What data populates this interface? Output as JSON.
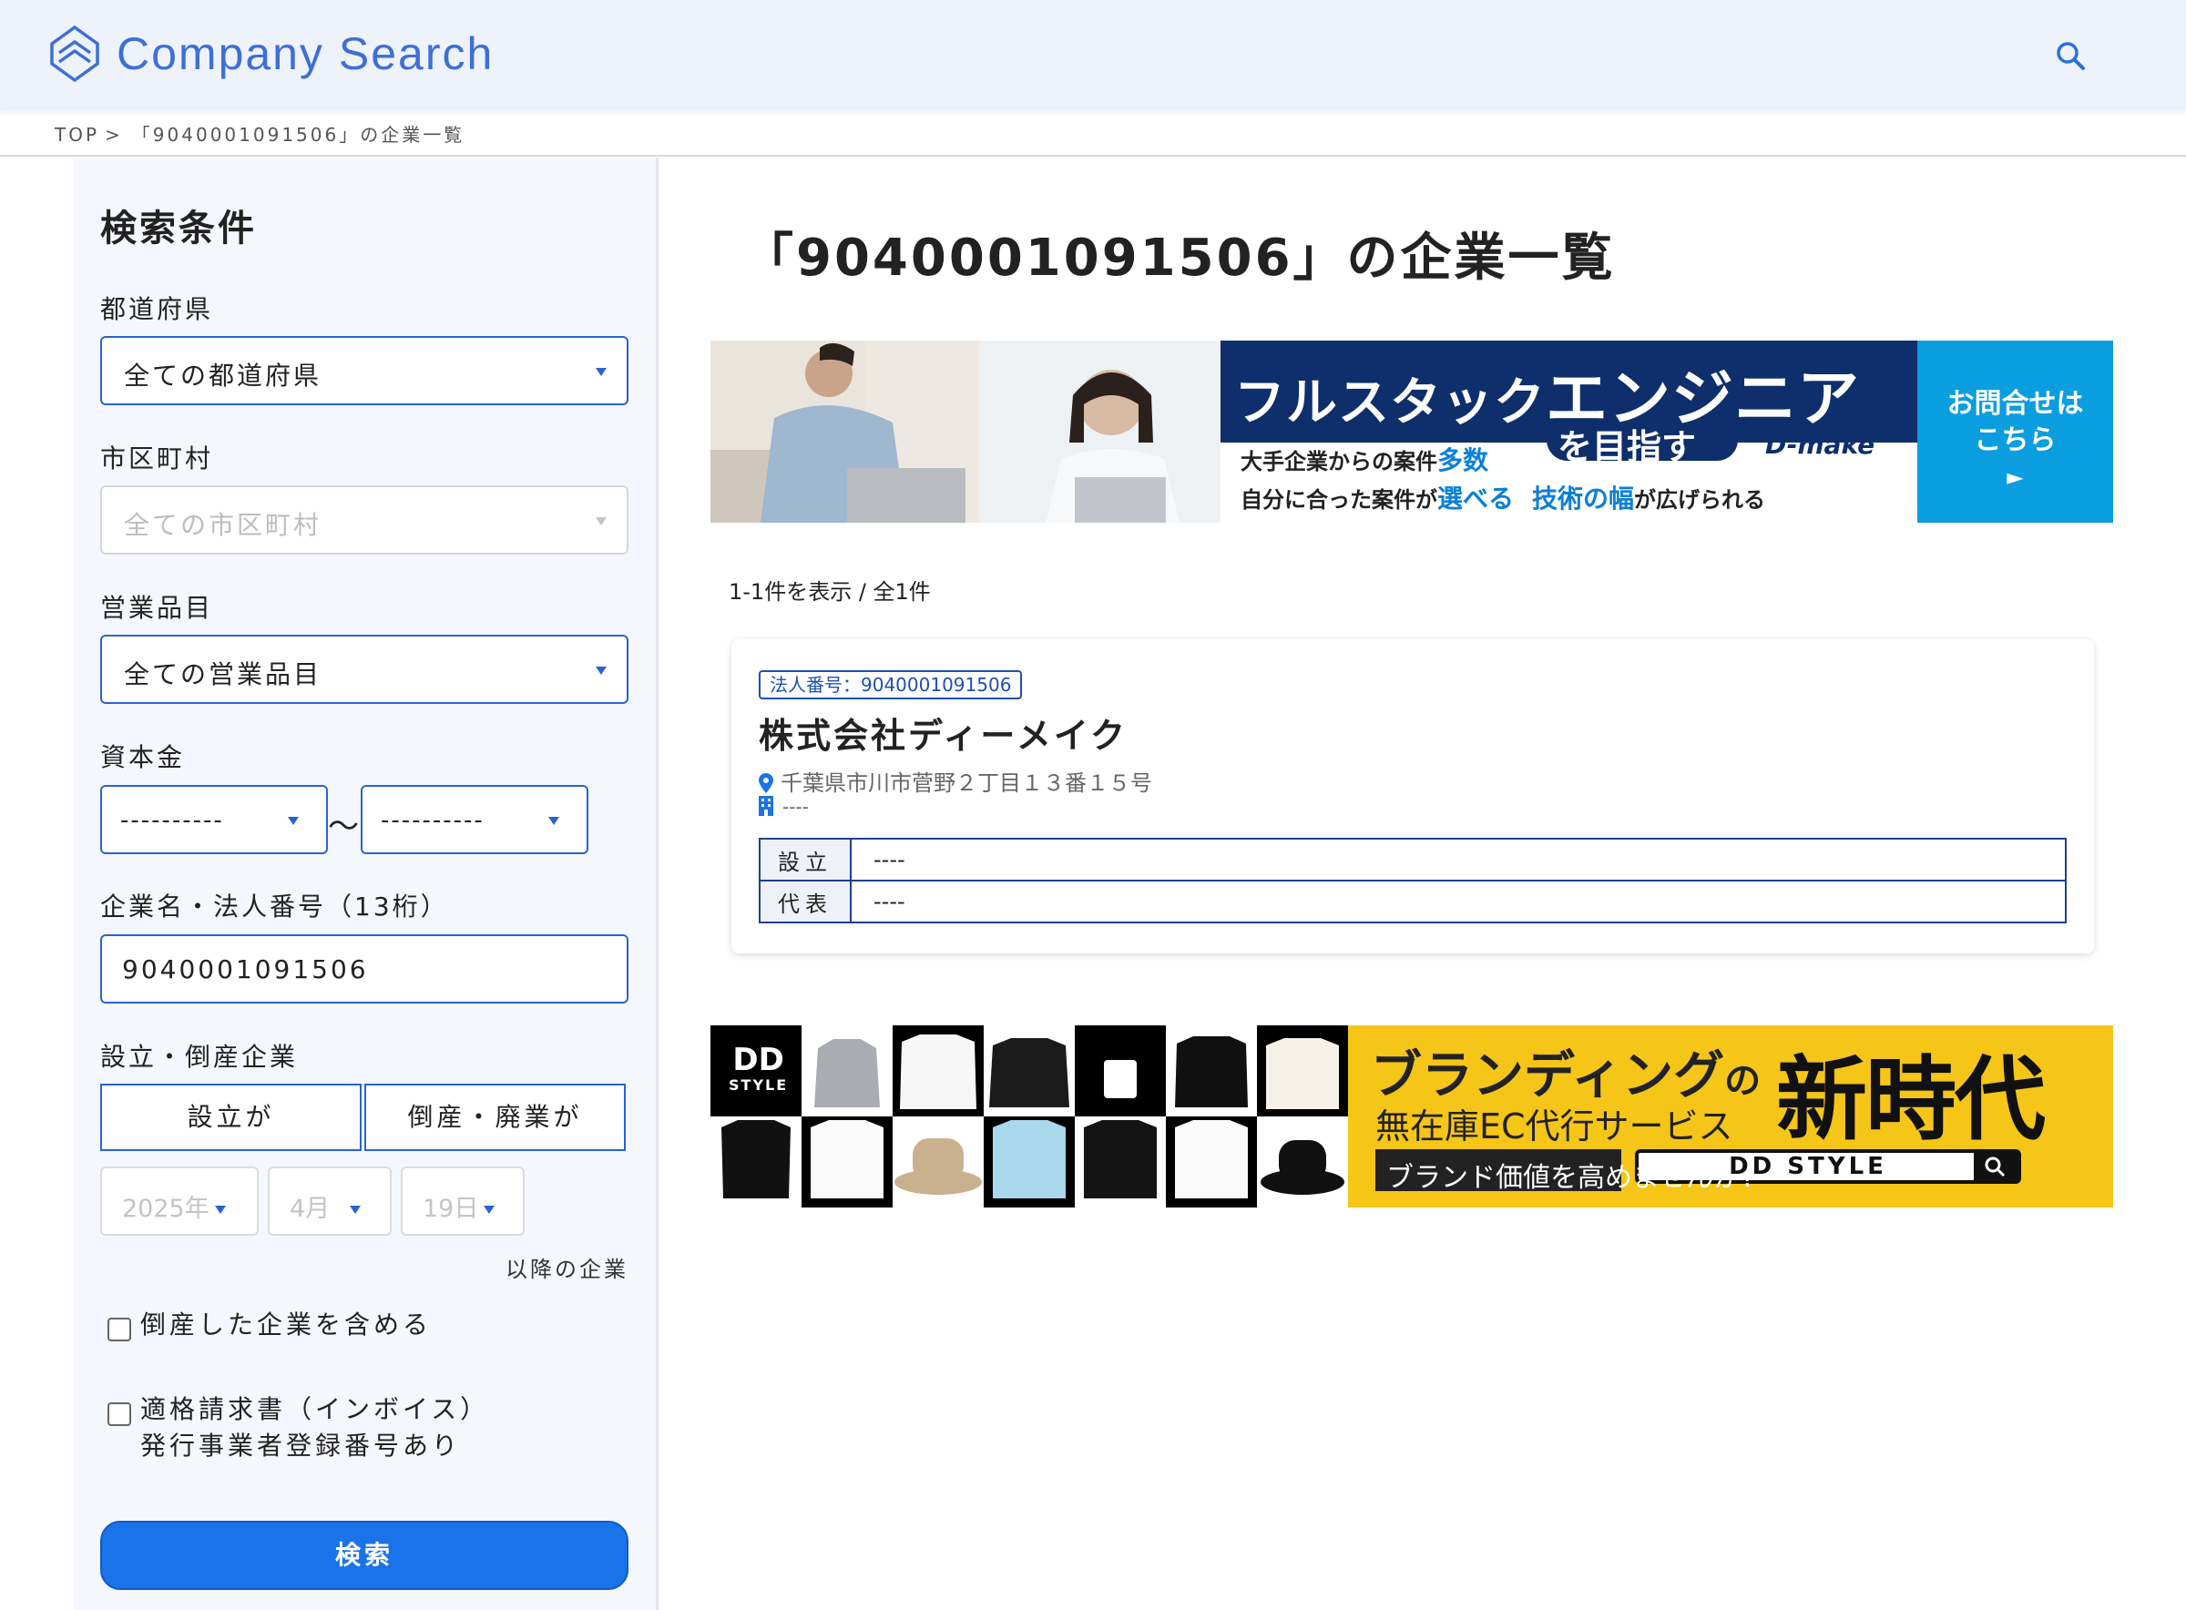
{
  "header": {
    "logo_text": "Company Search",
    "search_icon": "search-icon"
  },
  "breadcrumb": {
    "top": "TOP",
    "separator": ">",
    "current": "「9040001091506」の企業一覧"
  },
  "sidebar": {
    "title": "検索条件",
    "prefecture": {
      "label": "都道府県",
      "value": "全ての都道府県"
    },
    "city": {
      "label": "市区町村",
      "value": "全ての市区町村"
    },
    "product": {
      "label": "営業品目",
      "value": "全ての営業品目"
    },
    "capital": {
      "label": "資本金",
      "min": "----------",
      "max": "----------",
      "tilde": "〜"
    },
    "name": {
      "label": "企業名・法人番号（13桁）",
      "value": "9040001091506"
    },
    "founding": {
      "label": "設立・倒産企業",
      "option_established": "設立が",
      "option_closed": "倒産・廃業が",
      "year": "2025年",
      "month": "4月",
      "day": "19日",
      "after_text": "以降の企業"
    },
    "include_bankrupt": "倒産した企業を含める",
    "invoice_line1": "適格請求書（インボイス）",
    "invoice_line2": "発行事業者登録番号あり",
    "submit": "検索"
  },
  "main": {
    "title": "「9040001091506」の企業一覧",
    "count_text": "1-1件を表示 / 全1件",
    "banner1": {
      "headline_a": "フルスタック",
      "headline_b": "エンジニア",
      "sub": "を目指す",
      "brand": "D-make",
      "line1_a": "大手企業からの案件",
      "line1_b": "多数",
      "line2_a": "自分に合った案件が",
      "line2_b": "選べる",
      "line2_c": "技術の幅",
      "line2_d": "が広げられる",
      "cta_line1": "お問合せは",
      "cta_line2": "こちら",
      "cta_arrow": "►"
    },
    "company": {
      "badge": "法人番号：9040001091506",
      "name": "株式会社ディーメイク",
      "address": "千葉県市川市菅野２丁目１３番１５号",
      "industry": "----",
      "rows": [
        {
          "key": "設立",
          "value": "----"
        },
        {
          "key": "代表",
          "value": "----"
        }
      ]
    },
    "banner2": {
      "logo_line1": "DD",
      "logo_line2": "STYLE",
      "headline_a": "ブランディング",
      "headline_b": "の",
      "big": "新時代",
      "sub": "無在庫EC代行サービス",
      "pill": "ブランド価値を高めませんか?",
      "search_label": "DD STYLE"
    }
  },
  "colors": {
    "accent": "#2a62d4",
    "primary_button": "#1a73e8",
    "header_bg": "#eef2fb",
    "sidebar_bg": "#f4f7fd",
    "banner_blue": "#0a9ee0",
    "banner_navy": "#0e2f6b",
    "banner_yellow": "#f5c518"
  }
}
